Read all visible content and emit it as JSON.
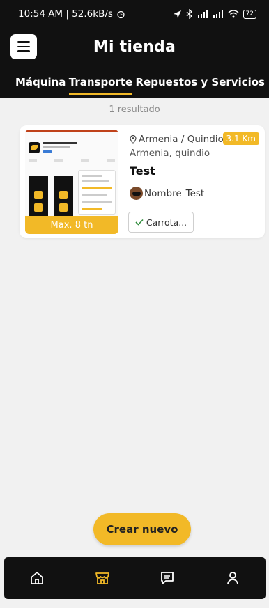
{
  "status_bar": {
    "time_speed": "10:54 AM | 52.6kB/s",
    "battery": "72"
  },
  "header": {
    "title": "Mi tienda"
  },
  "tabs": [
    {
      "label": "Máquina",
      "active": false
    },
    {
      "label": "Transporte",
      "active": true
    },
    {
      "label": "Repuestos y Servicios",
      "active": false
    }
  ],
  "results": {
    "count_text": "1 resultado"
  },
  "listing": {
    "capacity": "Max. 8 tn",
    "distance": "3.1 Km",
    "location": "Armenia / Quindio",
    "sub_location": "Armenia, quindio",
    "name": "Test",
    "owner_name": "Nombre",
    "owner_surname": "Test",
    "vehicle_type": "Carrota..."
  },
  "fab": {
    "label": "Crear nuevo"
  },
  "nav": [
    {
      "icon": "home-icon",
      "active": false
    },
    {
      "icon": "store-icon",
      "active": true
    },
    {
      "icon": "chat-icon",
      "active": false
    },
    {
      "icon": "user-icon",
      "active": false
    }
  ],
  "colors": {
    "accent": "#f2b927",
    "dark": "#111111",
    "background": "#f1f1f1"
  }
}
